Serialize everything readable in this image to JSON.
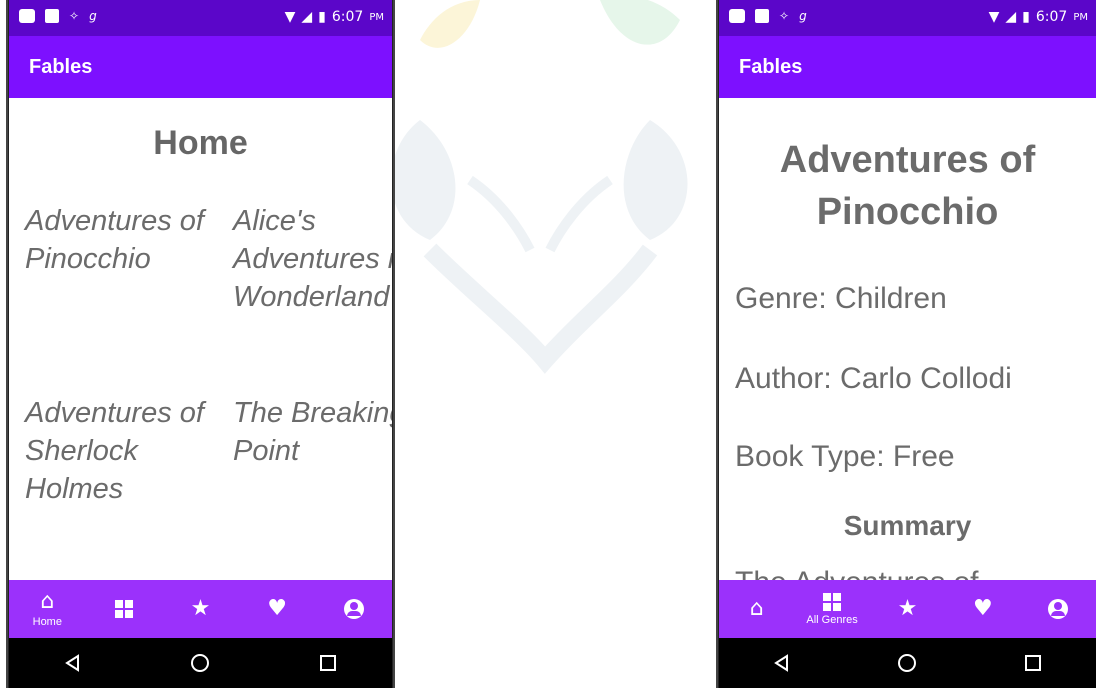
{
  "colors": {
    "status_bar": "#5b06c9",
    "app_bar": "#7d10ff",
    "bottom_nav": "#9b31fb",
    "text_gray": "#6b6b6b"
  },
  "status_bar": {
    "carrier_glyph": "g",
    "time": "6:07",
    "ampm": "PM"
  },
  "left_screen": {
    "app_title": "Fables",
    "heading": "Home",
    "books": [
      "Adventures of Pinocchio",
      "Alice's Adventures in Wonderland",
      "Adventures of Sherlock Holmes",
      "The Breaking Point"
    ],
    "nav": [
      {
        "icon": "home-icon",
        "label": "Home",
        "selected": true
      },
      {
        "icon": "genres-grid-icon",
        "label": "",
        "selected": false
      },
      {
        "icon": "star-icon",
        "label": "",
        "selected": false
      },
      {
        "icon": "heart-icon",
        "label": "",
        "selected": false
      },
      {
        "icon": "account-icon",
        "label": "",
        "selected": false
      }
    ]
  },
  "right_screen": {
    "app_title": "Fables",
    "book_title": "Adventures of Pinocchio",
    "genre": "Genre: Children",
    "author": "Author: Carlo Collodi",
    "book_type": "Book Type: Free",
    "summary_heading": "Summary",
    "summary_text": "The Adventures of",
    "nav": [
      {
        "icon": "home-icon",
        "label": "",
        "selected": false
      },
      {
        "icon": "genres-grid-icon",
        "label": "All Genres",
        "selected": true
      },
      {
        "icon": "star-icon",
        "label": "",
        "selected": false
      },
      {
        "icon": "heart-icon",
        "label": "",
        "selected": false
      },
      {
        "icon": "account-icon",
        "label": "",
        "selected": false
      }
    ]
  },
  "system_nav": [
    "back-icon",
    "home-circle-icon",
    "recents-icon"
  ]
}
